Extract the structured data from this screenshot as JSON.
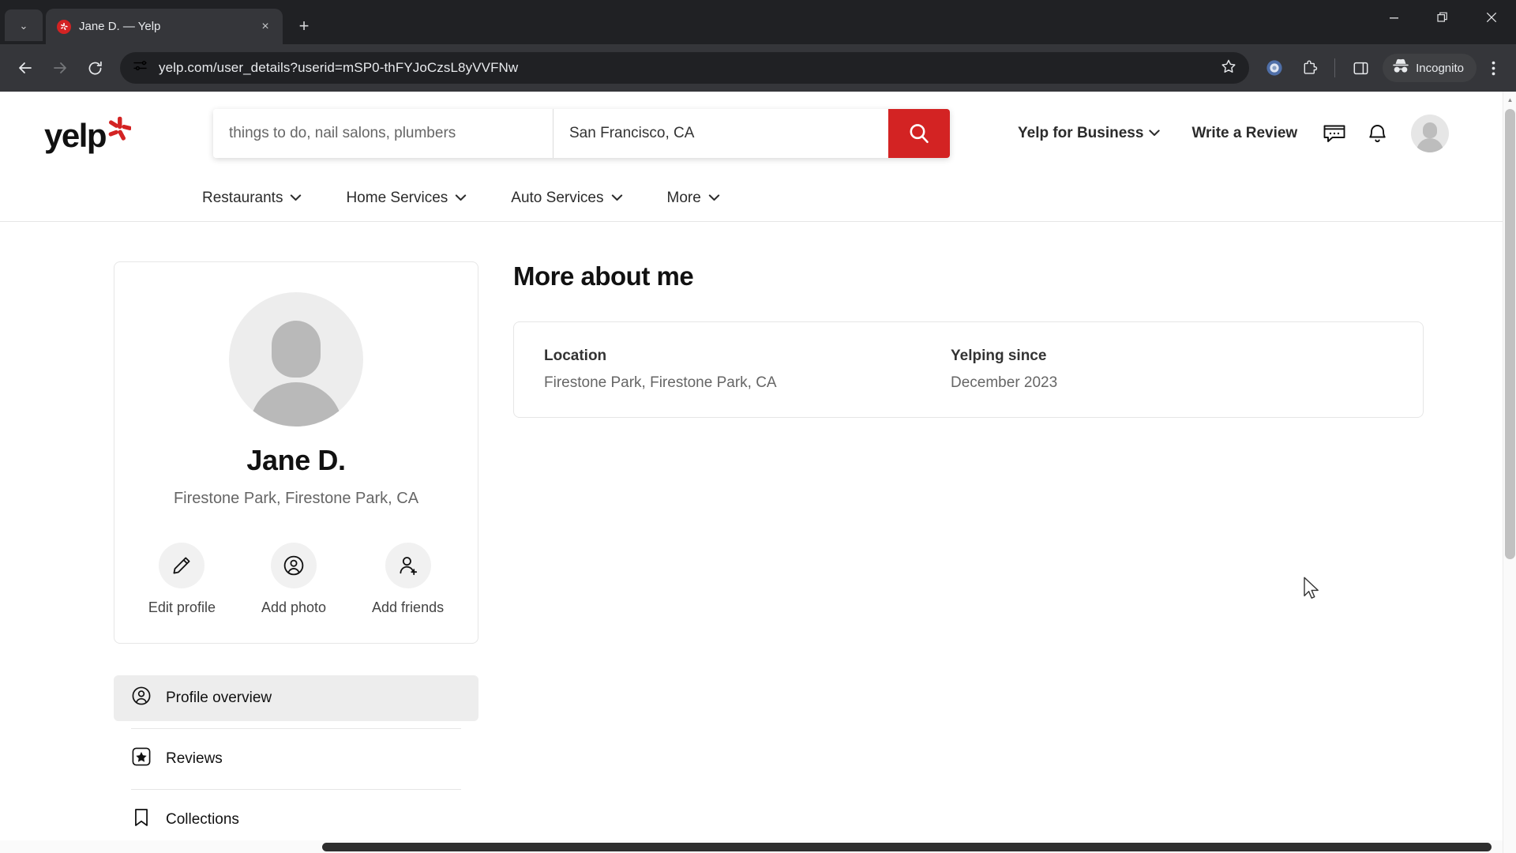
{
  "browser": {
    "tab": {
      "title": "Jane D. — Yelp",
      "favicon": "yelp-burst-icon",
      "close_label": "×"
    },
    "newtab_label": "+",
    "tabstrip_menu_label": "⌄",
    "window": {
      "minimize": "—",
      "restore": "❐",
      "close": "✕"
    },
    "toolbar": {
      "back": "←",
      "forward": "→",
      "reload": "⟳",
      "site_info_icon": "tune-icon",
      "url": "yelp.com/user_details?userid=mSP0-thFYJoCzsL8yVVFNw",
      "bookmark_icon": "star-icon",
      "extension_icon": "extensions-icon",
      "split_icon": "side-panel-icon",
      "incognito_label": "Incognito",
      "menu_label": "⋮"
    }
  },
  "header": {
    "logo_text": "yelp",
    "search": {
      "find_placeholder": "things to do, nail salons, plumbers",
      "find_value": "",
      "near_placeholder": "San Francisco, CA",
      "near_value": "San Francisco, CA",
      "button_icon": "search-icon",
      "button_color": "#d32323"
    },
    "links": [
      {
        "label": "Yelp for Business",
        "caret": "⌄"
      },
      {
        "label": "Write a Review",
        "caret": ""
      }
    ],
    "icons": [
      {
        "name": "messages-icon"
      },
      {
        "name": "notifications-bell-icon"
      },
      {
        "name": "user-avatar"
      }
    ]
  },
  "subnav": {
    "items": [
      {
        "label": "Restaurants",
        "caret": "⌄"
      },
      {
        "label": "Home Services",
        "caret": "⌄"
      },
      {
        "label": "Auto Services",
        "caret": "⌄"
      },
      {
        "label": "More",
        "caret": "⌄"
      }
    ]
  },
  "profile": {
    "name": "Jane D.",
    "location": "Firestone Park, Firestone Park, CA",
    "actions": [
      {
        "label": "Edit profile",
        "icon": "pencil-icon"
      },
      {
        "label": "Add photo",
        "icon": "person-circle-icon"
      },
      {
        "label": "Add friends",
        "icon": "person-add-icon"
      }
    ]
  },
  "sidenav": {
    "items": [
      {
        "label": "Profile overview",
        "icon": "person-circle-icon",
        "active": true
      },
      {
        "label": "Reviews",
        "icon": "star-square-icon",
        "active": false
      },
      {
        "label": "Collections",
        "icon": "bookmark-icon",
        "active": false
      }
    ]
  },
  "main": {
    "section_title": "More about me",
    "info": [
      {
        "label": "Location",
        "value": "Firestone Park, Firestone Park, CA"
      },
      {
        "label": "Yelping since",
        "value": "December 2023"
      }
    ]
  }
}
